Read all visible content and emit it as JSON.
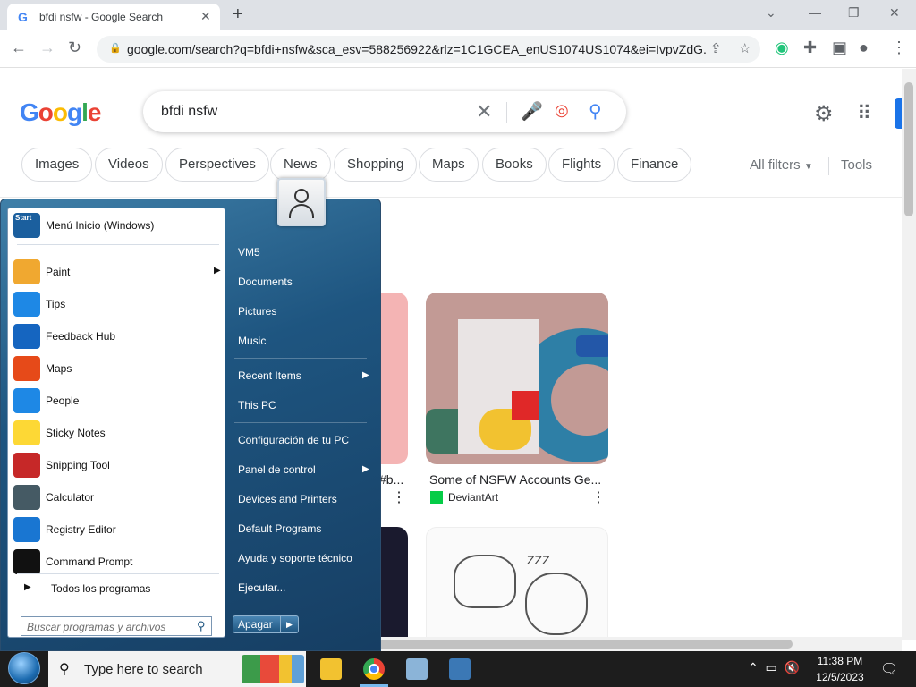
{
  "browser": {
    "tab_title": "bfdi nsfw - Google Search",
    "url": "google.com/search?q=bfdi+nsfw&sca_esv=588256922&rlz=1C1GCEA_enUS1074US1074&ei=IvpvZdG...",
    "new_tab": "+"
  },
  "google": {
    "logo": "Google",
    "query": "bfdi nsfw",
    "chips": [
      "Images",
      "Videos",
      "Perspectives",
      "News",
      "Shopping",
      "Maps",
      "Books",
      "Flights",
      "Finance"
    ],
    "all_filters": "All filters",
    "tools": "Tools"
  },
  "results": {
    "partial_caption": "#b...",
    "card1_caption": "Some of NSFW Accounts Ge...",
    "card1_source": "DeviantArt",
    "zzz": "ZZZ"
  },
  "start_menu": {
    "programs": [
      {
        "label": "Menú Inicio (Windows)",
        "icon": "start-menu-icon",
        "color": "#1b5f9e"
      },
      {
        "label": "Paint",
        "icon": "paint-icon",
        "color": "#f0a830",
        "arrow": true
      },
      {
        "label": "Tips",
        "icon": "lightbulb-icon",
        "color": "#1e88e5"
      },
      {
        "label": "Feedback Hub",
        "icon": "feedback-icon",
        "color": "#1565c0"
      },
      {
        "label": "Maps",
        "icon": "map-pin-icon",
        "color": "#e64a19"
      },
      {
        "label": "People",
        "icon": "people-icon",
        "color": "#1e88e5"
      },
      {
        "label": "Sticky Notes",
        "icon": "sticky-note-icon",
        "color": "#fdd835"
      },
      {
        "label": "Snipping Tool",
        "icon": "scissors-icon",
        "color": "#c62828"
      },
      {
        "label": "Calculator",
        "icon": "calculator-icon",
        "color": "#455a64"
      },
      {
        "label": "Registry Editor",
        "icon": "registry-icon",
        "color": "#1976d2"
      },
      {
        "label": "Command Prompt",
        "icon": "terminal-icon",
        "color": "#111111"
      }
    ],
    "start_icon_text": "Start",
    "all_programs": "Todos los programas",
    "search_placeholder": "Buscar programas y archivos",
    "right_items": [
      "VM5",
      "Documents",
      "Pictures",
      "Music",
      "Recent Items",
      "This PC",
      "Configuración de tu PC",
      "Panel de control",
      "Devices and Printers",
      "Default Programs",
      "Ayuda y soporte técnico",
      "Ejecutar..."
    ],
    "shutdown": "Apagar"
  },
  "taskbar": {
    "search_text": "Type here to search",
    "time": "11:38 PM",
    "date": "12/5/2023"
  }
}
